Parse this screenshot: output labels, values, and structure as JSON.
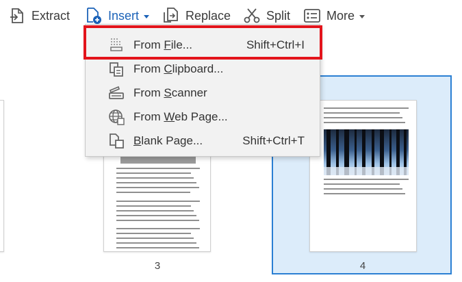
{
  "toolbar": {
    "extract": {
      "label": "Extract",
      "icon": "extract-icon"
    },
    "insert": {
      "label": "Insert",
      "icon": "insert-page-icon",
      "color": "#1b62b8"
    },
    "replace": {
      "label": "Replace",
      "icon": "replace-icon"
    },
    "split": {
      "label": "Split",
      "icon": "scissors-icon"
    },
    "more": {
      "label": "More",
      "icon": "more-icon"
    }
  },
  "insert_menu": {
    "items": [
      {
        "pre": "From ",
        "key": "F",
        "post": "ile...",
        "shortcut": "Shift+Ctrl+I",
        "icon": "from-file-icon"
      },
      {
        "pre": "From ",
        "key": "C",
        "post": "lipboard...",
        "shortcut": "",
        "icon": "from-clipboard-icon"
      },
      {
        "pre": "From ",
        "key": "S",
        "post": "canner",
        "shortcut": "",
        "icon": "from-scanner-icon"
      },
      {
        "pre": "From ",
        "key": "W",
        "post": "eb Page...",
        "shortcut": "",
        "icon": "from-web-page-icon"
      },
      {
        "pre": "",
        "key": "B",
        "post": "lank Page...",
        "shortcut": "Shift+Ctrl+T",
        "icon": "blank-page-icon"
      }
    ]
  },
  "pages": [
    {
      "number": "3"
    },
    {
      "number": "4",
      "selected": true
    }
  ],
  "colors": {
    "highlight": "#e3141b",
    "selection_border": "#2a7fd3",
    "selection_fill": "#dcecfa"
  }
}
